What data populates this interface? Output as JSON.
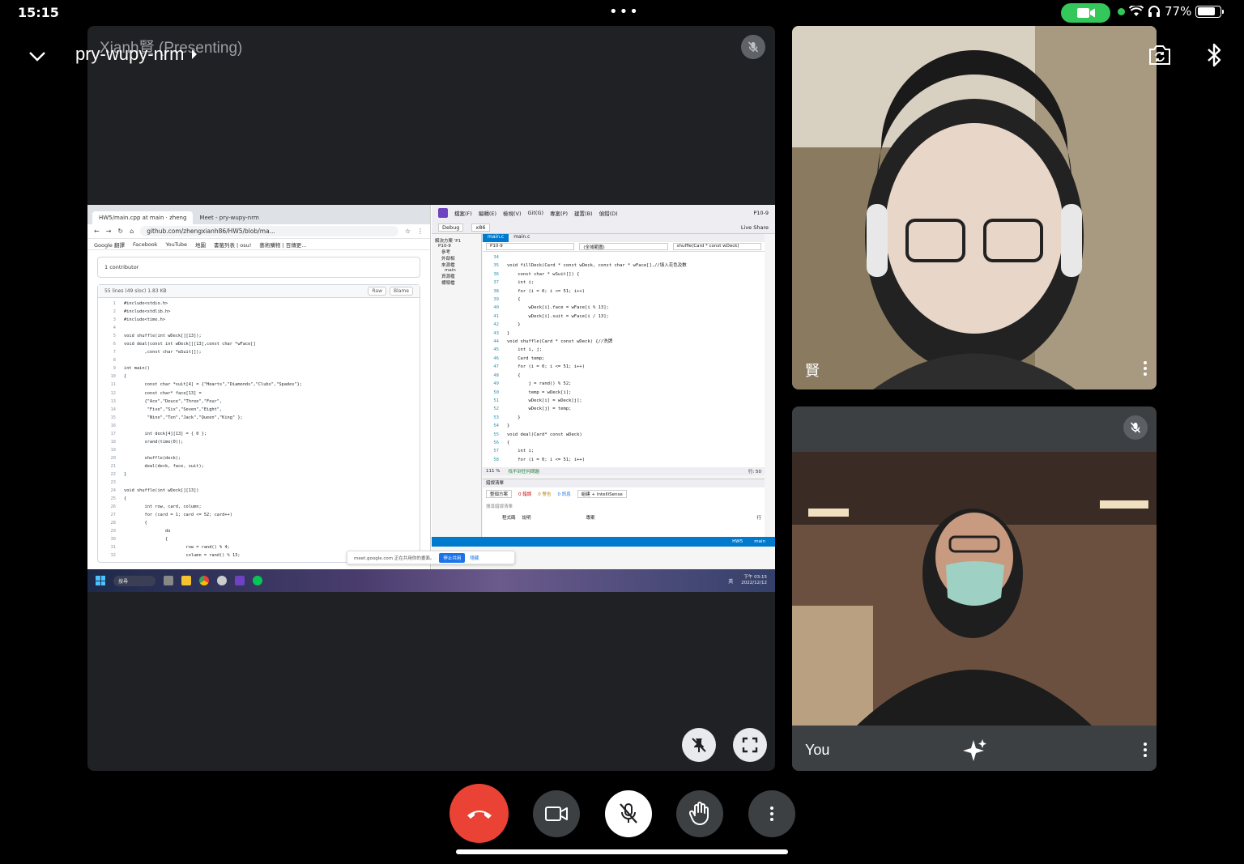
{
  "status_bar": {
    "time": "15:15",
    "battery_percent": "77%",
    "battery_level": 0.77,
    "camera_active_color": "#34c759"
  },
  "header": {
    "meeting_code": "pry-wupy-nrm",
    "presenter_label": "Xianh賢 (Presenting)"
  },
  "shared_screen": {
    "browser": {
      "tabs": [
        "HW5/main.cpp at main · zheng",
        "Meet - pry-wupy-nrm"
      ],
      "url": "github.com/zhengxianh86/HW5/blob/ma...",
      "bookmarks": [
        "Google 翻譯",
        "Facebook",
        "YouTube",
        "地圖",
        "書籤列表 | osu!",
        "藝術購物 | 百傳更..."
      ],
      "contributors": "1 contributor",
      "file_info": "55 lines (49 sloc)   1.83 KB",
      "raw_label": "Raw",
      "blame_label": "Blame",
      "code_lines": [
        {
          "n": "1",
          "t": "#include<stdio.h>"
        },
        {
          "n": "2",
          "t": "#include<stdlib.h>"
        },
        {
          "n": "3",
          "t": "#include<time.h>"
        },
        {
          "n": "4",
          "t": ""
        },
        {
          "n": "5",
          "t": "void shuffle(int wDeck[][13]);"
        },
        {
          "n": "6",
          "t": "void deal(const int wDeck[][13],const char *wFace[]"
        },
        {
          "n": "7",
          "t": "        ,const char *wSuit[]);"
        },
        {
          "n": "8",
          "t": ""
        },
        {
          "n": "9",
          "t": "int main()"
        },
        {
          "n": "10",
          "t": "{"
        },
        {
          "n": "11",
          "t": "        const char *suit[4] = {\"Hearts\",\"Diamonds\",\"Clubs\",\"Spades\"};"
        },
        {
          "n": "12",
          "t": "        const char* face[13] ="
        },
        {
          "n": "13",
          "t": "        {\"Ace\",\"Deuce\",\"Three\",\"Four\","
        },
        {
          "n": "14",
          "t": "         \"Five\",\"Six\",\"Seven\",\"Eight\","
        },
        {
          "n": "15",
          "t": "         \"Nine\",\"Ten\",\"Jack\",\"Queen\",\"King\" };"
        },
        {
          "n": "16",
          "t": ""
        },
        {
          "n": "17",
          "t": "        int deck[4][13] = { 0 };"
        },
        {
          "n": "18",
          "t": "        srand(time(0));"
        },
        {
          "n": "19",
          "t": ""
        },
        {
          "n": "20",
          "t": "        shuffle(deck);"
        },
        {
          "n": "21",
          "t": "        deal(deck, face, suit);"
        },
        {
          "n": "22",
          "t": "}"
        },
        {
          "n": "23",
          "t": ""
        },
        {
          "n": "24",
          "t": "void shuffle(int wDeck[][13])"
        },
        {
          "n": "25",
          "t": "{"
        },
        {
          "n": "26",
          "t": "        int row, card, column;"
        },
        {
          "n": "27",
          "t": "        for (card = 1; card <= 52; card++)"
        },
        {
          "n": "28",
          "t": "        {"
        },
        {
          "n": "29",
          "t": "                do"
        },
        {
          "n": "30",
          "t": "                {"
        },
        {
          "n": "31",
          "t": "                        row = rand() % 4;"
        },
        {
          "n": "32",
          "t": "                        column = rand() % 13;"
        }
      ]
    },
    "vs": {
      "menu": [
        "檔案(F)",
        "編輯(E)",
        "檢視(V)",
        "Git(G)",
        "專案(P)",
        "建置(B)",
        "偵錯(D)"
      ],
      "project": "P10-9",
      "config": "Debug",
      "platform": "x86",
      "live_share": "Live Share",
      "tabs": [
        "main.c",
        "main.c"
      ],
      "nav": [
        "P10-9",
        "(全域範圍)",
        "shuffle(Card * const wDeck)"
      ],
      "solution_items": [
        "解決方案 'P1",
        "P10-9",
        "參考",
        "外部相",
        "來源檔",
        "main",
        "資源檔",
        "標頭檔"
      ],
      "code_lines": [
        {
          "n": "34",
          "t": ""
        },
        {
          "n": "35",
          "t": "void fillDeck(Card * const wDeck, const char * wFace[],//填入花色及數"
        },
        {
          "n": "36",
          "t": "    const char * wSuit[]) {"
        },
        {
          "n": "37",
          "t": "    int i;"
        },
        {
          "n": "38",
          "t": "    for (i = 0; i <= 51; i++)"
        },
        {
          "n": "39",
          "t": "    {"
        },
        {
          "n": "40",
          "t": "        wDeck[i].face = wFace[i % 13];"
        },
        {
          "n": "41",
          "t": "        wDeck[i].suit = wFace[i / 13];"
        },
        {
          "n": "42",
          "t": "    }"
        },
        {
          "n": "43",
          "t": "}"
        },
        {
          "n": "44",
          "t": "void shuffle(Card * const wDeck) {//洗牌"
        },
        {
          "n": "45",
          "t": "    int i, j;"
        },
        {
          "n": "46",
          "t": "    Card temp;"
        },
        {
          "n": "47",
          "t": "    for (i = 0; i <= 51; i++)"
        },
        {
          "n": "48",
          "t": "    {"
        },
        {
          "n": "49",
          "t": "        j = rand() % 52;"
        },
        {
          "n": "50",
          "t": "        temp = wDeck[i];"
        },
        {
          "n": "51",
          "t": "        wDeck[i] = wDeck[j];"
        },
        {
          "n": "52",
          "t": "        wDeck[j] = temp;"
        },
        {
          "n": "53",
          "t": "    }"
        },
        {
          "n": "54",
          "t": "}"
        },
        {
          "n": "55",
          "t": "void deal(Card* const wDeck)"
        },
        {
          "n": "56",
          "t": "{"
        },
        {
          "n": "57",
          "t": "    int i;"
        },
        {
          "n": "58",
          "t": "    for (i = 0; i <= 51; i++)"
        }
      ],
      "zoom": "111 %",
      "no_issues": "找不到任何問題",
      "line_info": "行: 50",
      "error_list_title": "錯誤清單",
      "error_scope": "整個方案",
      "errors": "0 錯誤",
      "warnings": "0 警告",
      "messages": "0 訊息",
      "build_filter": "組建 + IntelliSense",
      "search_errors": "搜尋錯誤清單",
      "col_code": "程式碼",
      "col_desc": "說明",
      "col_project": "專案",
      "col_line": "行",
      "branch": "main",
      "repo": "HW5"
    },
    "meet_bar": {
      "text": "meet.google.com 正在共用你的畫面。",
      "stop": "停止共用",
      "hide": "隱藏"
    },
    "taskbar": {
      "search": "搜尋",
      "time": "下午 03:15",
      "date": "2022/12/12",
      "lang": "英"
    }
  },
  "participants": [
    {
      "name": "賢"
    },
    {
      "name": "You"
    }
  ],
  "colors": {
    "end_call": "#ea4335",
    "tile_bg": "#3c4043",
    "main_bg": "#202124"
  },
  "icons": [
    "chevron-down-icon",
    "switch-camera-icon",
    "bluetooth-icon",
    "mic-off-icon",
    "unpin-icon",
    "fullscreen-icon",
    "more-vert-icon",
    "sparkle-icon",
    "end-call-icon",
    "camera-icon",
    "raise-hand-icon"
  ]
}
